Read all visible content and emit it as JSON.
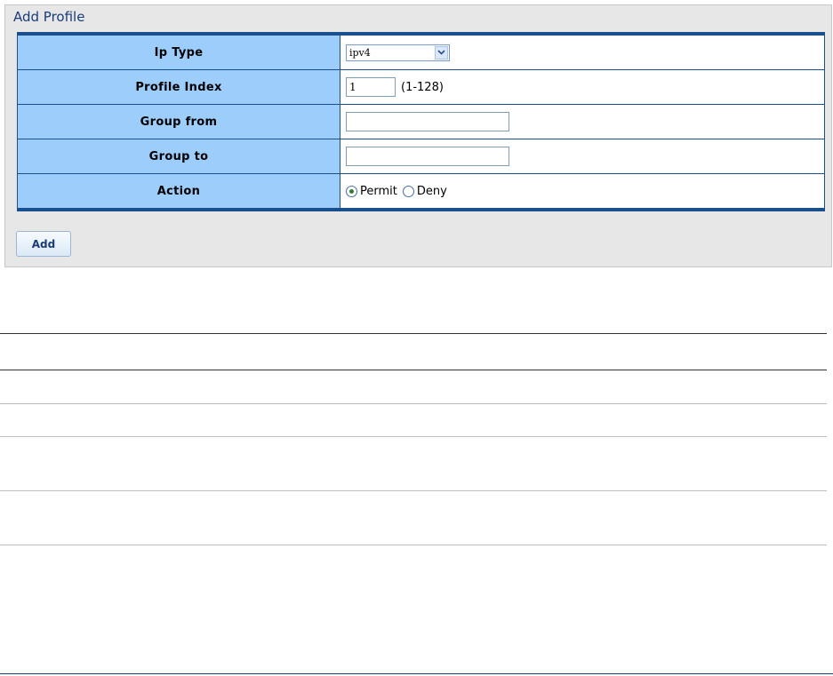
{
  "panel": {
    "title": "Add Profile",
    "rows": {
      "ip_type": {
        "label": "Ip Type",
        "selected": "ipv4"
      },
      "profile_index": {
        "label": "Profile Index",
        "value": "1",
        "hint": "(1-128)"
      },
      "group_from": {
        "label": "Group from",
        "value": ""
      },
      "group_to": {
        "label": "Group to",
        "value": ""
      },
      "action": {
        "label": "Action",
        "options": [
          "Permit",
          "Deny"
        ],
        "selected": "Permit"
      }
    },
    "add_button": "Add"
  },
  "colors": {
    "label_bg": "#9dcdfb",
    "border": "#1a4f8e",
    "panel_bg": "#e7e7e7",
    "title": "#1a3c78"
  }
}
